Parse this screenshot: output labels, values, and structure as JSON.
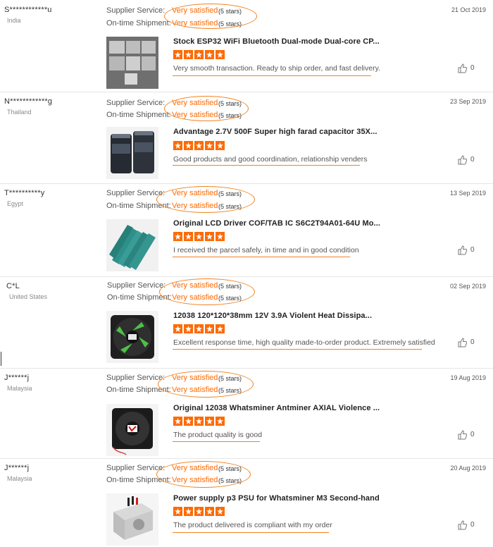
{
  "labels": {
    "supplier_service": "Supplier Service:",
    "ontime_shipment": "On-time Shipment:"
  },
  "reviews": [
    {
      "buyer": "S************u",
      "country": "India",
      "date": "21 Oct 2019",
      "supplier_rating": "Very satisfied",
      "shipment_rating": "Very satisfied",
      "stars_text": "(5 stars)",
      "product": "Stock ESP32 WiFi Bluetooth Dual-mode Dual-core CP...",
      "star_count": 5,
      "feedback": "Very smooth transaction. Ready to ship order, and fast delivery.",
      "likes": "0",
      "thumb_icon": "esp32-module-image"
    },
    {
      "buyer": "N************g",
      "country": "Thailand",
      "date": "23 Sep 2019",
      "supplier_rating": "Very satisfied",
      "shipment_rating": "Very satisfied",
      "stars_text": "(5 stars)",
      "product": "Advantage 2.7V 500F Super high farad capacitor 35X...",
      "star_count": 5,
      "feedback": "Good products and good coordination, relationship venders",
      "likes": "0",
      "thumb_icon": "capacitor-image"
    },
    {
      "buyer": "T**********y",
      "country": "Egypt",
      "date": "13 Sep 2019",
      "supplier_rating": "Very satisfied",
      "shipment_rating": "Very satisfied",
      "stars_text": "(5 stars)",
      "product": "Original LCD Driver COF/TAB IC S6C2T94A01-64U Mo...",
      "star_count": 5,
      "feedback": "I received the parcel safely, in time and in good condition",
      "likes": "0",
      "thumb_icon": "lcd-driver-image"
    },
    {
      "buyer": "C*L",
      "country": "United States",
      "date": "02 Sep 2019",
      "supplier_rating": "Very satisfied",
      "shipment_rating": "Very satisfied",
      "stars_text": "(5 stars)",
      "product": "12038 120*120*38mm 12V 3.9A Violent Heat Dissipa...",
      "star_count": 5,
      "feedback": "Excellent response time, high quality made-to-order product. Extremely satisfied",
      "likes": "0",
      "thumb_icon": "cooling-fan-image"
    },
    {
      "buyer": "J******j",
      "country": "Malaysia",
      "date": "19 Aug 2019",
      "supplier_rating": "Very satisfied",
      "shipment_rating": "Very satisfied",
      "stars_text": "(5 stars)",
      "product": "Original 12038 Whatsminer Antminer AXIAL Violence ...",
      "star_count": 5,
      "feedback": "The product quality is good",
      "likes": "0",
      "thumb_icon": "axial-fan-image"
    },
    {
      "buyer": "J******j",
      "country": "Malaysia",
      "date": "20 Aug 2019",
      "supplier_rating": "Very satisfied",
      "shipment_rating": "Very satisfied",
      "stars_text": "(5 stars)",
      "product": "Power supply p3 PSU for Whatsminer M3 Second-hand",
      "star_count": 5,
      "feedback": "The product delivered is compliant with my order",
      "likes": "0",
      "thumb_icon": "psu-image"
    }
  ],
  "colors": {
    "accent": "#ff6a00",
    "annotation": "#f0821e"
  }
}
